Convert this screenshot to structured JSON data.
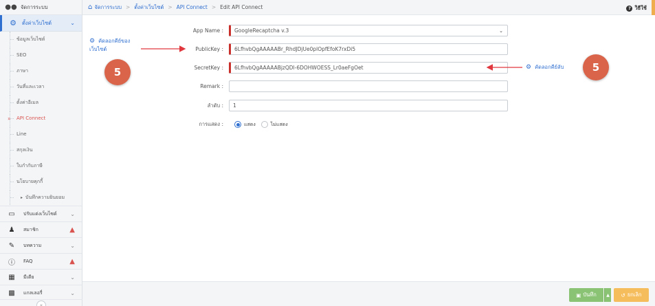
{
  "sidebar": {
    "top_label": "จัดการระบบ",
    "active_label": "ตั้งค่าเว็บไซต์",
    "sub_items": [
      "ข้อมูลเว็บไซต์",
      "SEO",
      "ภาษา",
      "วันที่และเวลา",
      "ตั้งค่าอีเมล",
      "API Connect",
      "Line",
      "สกุลเงิน",
      "ใบกำกับภาษี",
      "นโยบายคุกกี้"
    ],
    "nested_item": "บันทึกความยินยอม",
    "items": [
      {
        "label": "ปรับแต่งเว็บไซต์",
        "icon": "monitor-icon"
      },
      {
        "label": "สมาชิก",
        "icon": "user-icon"
      },
      {
        "label": "บทความ",
        "icon": "edit-icon"
      },
      {
        "label": "FAQ",
        "icon": "info-icon"
      },
      {
        "label": "มีเดีย",
        "icon": "film-icon"
      },
      {
        "label": "แกลเลอรี่",
        "icon": "grid-icon"
      }
    ]
  },
  "breadcrumb": {
    "items": [
      "จัดการระบบ",
      "ตั้งค่าเว็บไซต์",
      "API Connect"
    ],
    "current": "Edit API Connect",
    "help": "วิธีใช้"
  },
  "form": {
    "app_name_label": "App Name :",
    "app_name_value": "GoogleRecaptcha v.3",
    "public_key_label": "PublicKey :",
    "public_key_value": "6LfhvbQgAAAAABr_RhdJDjUe0plOpfEfoK7rxDi5",
    "secret_key_label": "SecretKey :",
    "secret_key_value": "6LfhvbQgAAAAABjzQDl-6DOHWOESS_Lr0aeFgOet",
    "remark_label": "Remark :",
    "remark_value": "",
    "order_label": "ลำดับ :",
    "order_value": "1",
    "display_label": "การแสดง :",
    "display_on": "แสดง",
    "display_off": "ไม่แสดง"
  },
  "annotations": {
    "left_line1": "คัดลอกคีย์ของ",
    "left_line2": "เว็บไซต์",
    "right_text": "คัดลอกคีย์ลับ",
    "badge": "5",
    "arrow_color": "#e0383e"
  },
  "footer": {
    "save": "บันทึก",
    "cancel": "ยกเลิก"
  }
}
